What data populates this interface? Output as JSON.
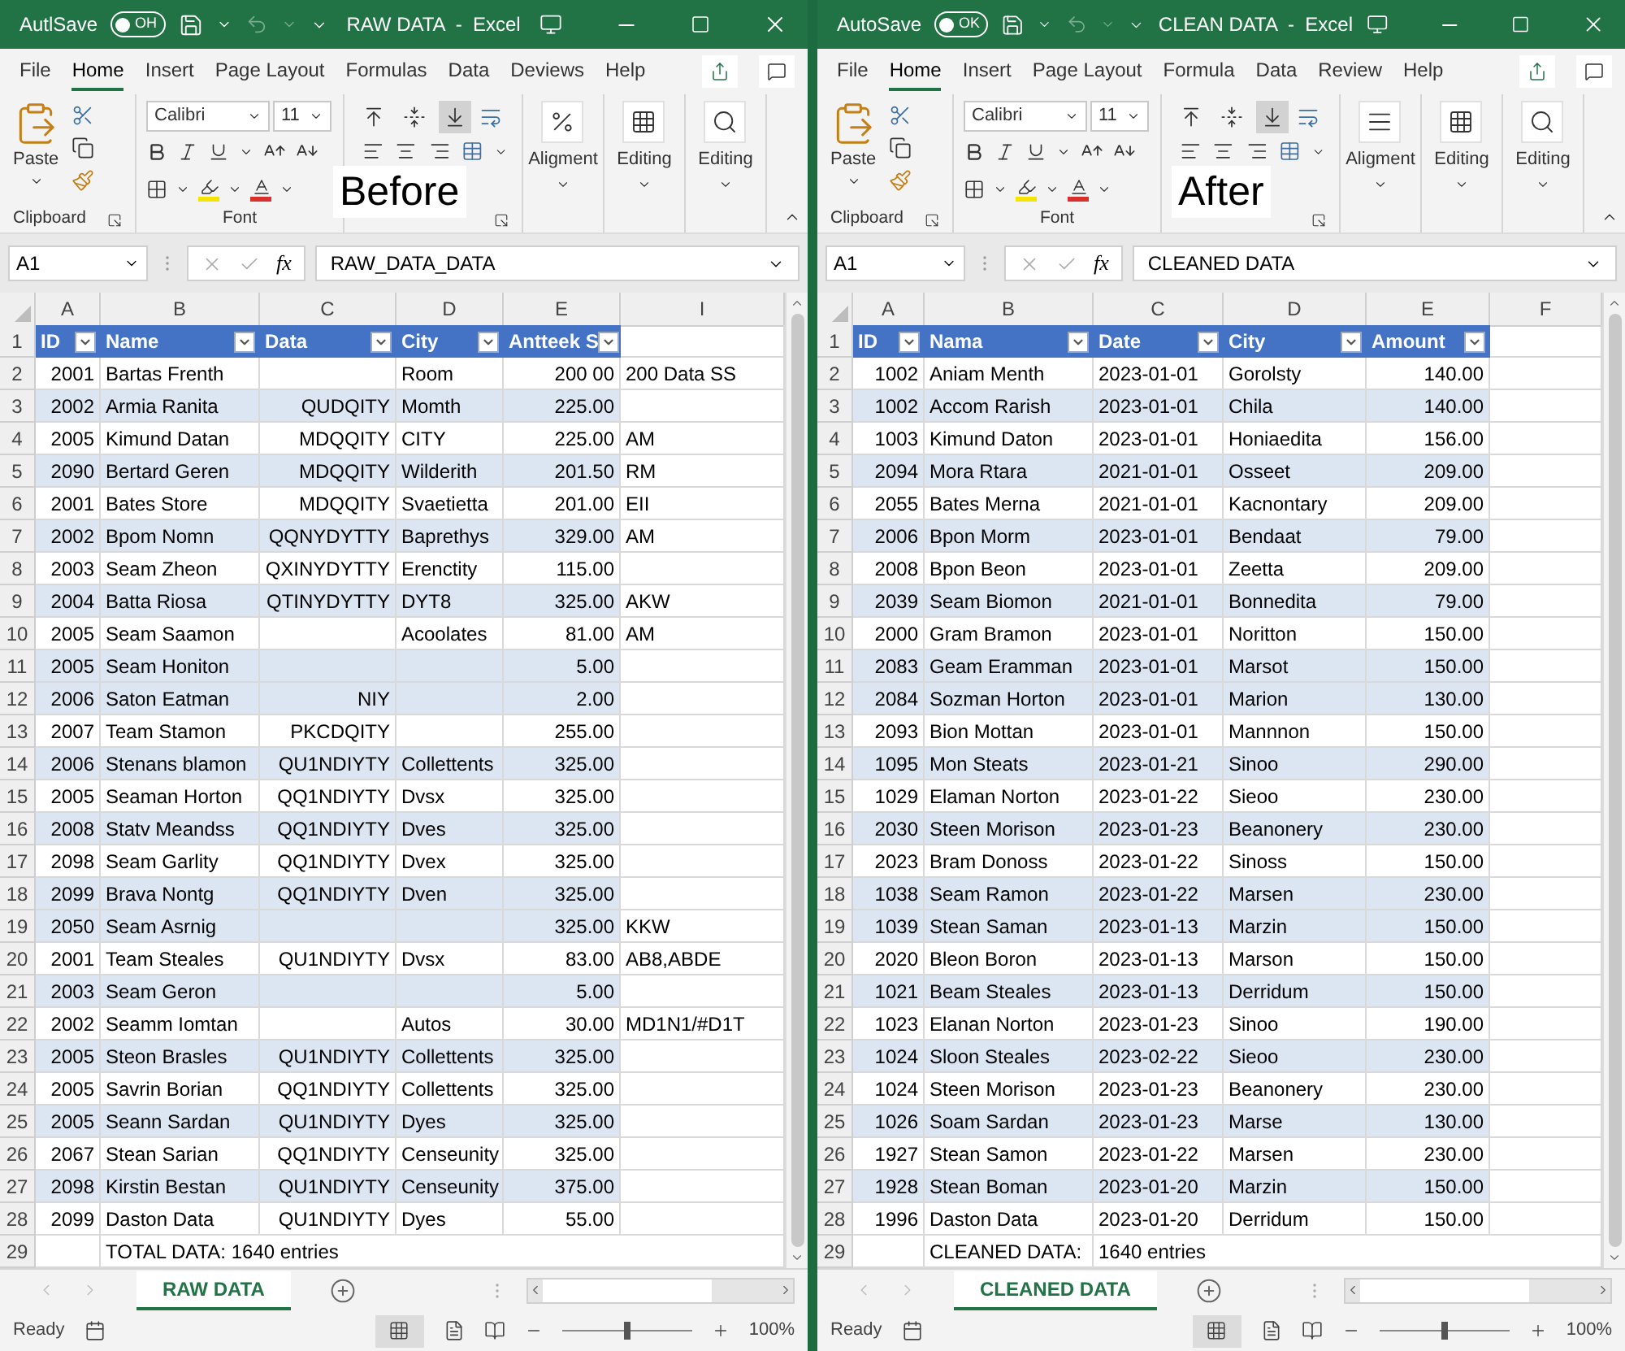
{
  "windows": [
    {
      "title": "RAW DATA  -  Excel",
      "autosave": {
        "label": "AutlSave",
        "toggle_text": "OH",
        "on": false
      },
      "menu_tabs": [
        {
          "label": "File",
          "selected": false
        },
        {
          "label": "Home",
          "selected": true
        },
        {
          "label": "Insert",
          "selected": false
        },
        {
          "label": "Page Layout",
          "selected": false
        },
        {
          "label": "Formulas",
          "selected": false
        },
        {
          "label": "Data",
          "selected": false
        },
        {
          "label": "Deviews",
          "selected": false
        },
        {
          "label": "Help",
          "selected": false
        }
      ],
      "ribbon": {
        "paste": "Paste",
        "clipboard_label": "Clipboard",
        "font": "Calibri",
        "font_size": "11",
        "font_label": "Font",
        "vertical_align": [
          {
            "kind": "top",
            "selected": false
          },
          {
            "kind": "middle",
            "selected": false
          },
          {
            "kind": "bottom",
            "selected": true
          }
        ],
        "big_buttons": [
          {
            "label": "Aligment",
            "kind": "percent"
          },
          {
            "label": "Editing",
            "kind": "table"
          },
          {
            "label": "Editing",
            "kind": "search"
          }
        ],
        "overlay": "Before"
      },
      "name_box": "A1",
      "fx": "fx",
      "formula": "RAW_DATA_DATA",
      "column_letters": [
        "A",
        "B",
        "C",
        "D",
        "E",
        "I"
      ],
      "rows": [
        {
          "number": "1",
          "kind": "header",
          "cells": [
            "ID",
            "Name",
            "Data",
            "City",
            "Antteek S",
            null
          ]
        },
        {
          "number": "2",
          "kind": "data",
          "shaded": false,
          "cells": [
            "2001",
            "Bartas Frenth",
            null,
            "Room",
            "200 00",
            "200 Data SS"
          ]
        },
        {
          "number": "3",
          "kind": "data",
          "shaded": true,
          "cells": [
            "2002",
            "Armia Ranita",
            "QUDQITY",
            "Momth",
            "225.00",
            null
          ]
        },
        {
          "number": "4",
          "kind": "data",
          "shaded": false,
          "cells": [
            "2005",
            "Kimund Datan",
            "MDQQITY",
            "CITY",
            "225.00",
            "AM"
          ]
        },
        {
          "number": "5",
          "kind": "data",
          "shaded": true,
          "cells": [
            "2090",
            "Bertard Geren",
            "MDQQITY",
            "Wilderith",
            "201.50",
            "RM"
          ]
        },
        {
          "number": "6",
          "kind": "data",
          "shaded": false,
          "cells": [
            "2001",
            "Bates Store",
            "MDQQITY",
            "Svaetietta",
            "201.00",
            "EII"
          ]
        },
        {
          "number": "7",
          "kind": "data",
          "shaded": true,
          "cells": [
            "2002",
            "Bpom Nomn",
            "QQNYDYTTY",
            "Baprethys",
            "329.00",
            "AM"
          ]
        },
        {
          "number": "8",
          "kind": "data",
          "shaded": false,
          "cells": [
            "2003",
            "Seam Zheon",
            "QXINYDYTTY",
            "Erenctity",
            "115.00",
            null
          ]
        },
        {
          "number": "9",
          "kind": "data",
          "shaded": true,
          "cells": [
            "2004",
            "Batta Riosa",
            "QTINYDYTTY",
            "DYT8",
            "325.00",
            "AKW"
          ]
        },
        {
          "number": "10",
          "kind": "data",
          "shaded": false,
          "cells": [
            "2005",
            "Seam Saamon",
            null,
            "Acoolates",
            "81.00",
            "AM"
          ]
        },
        {
          "number": "11",
          "kind": "data",
          "shaded": true,
          "cells": [
            "2005",
            "Seam Honiton",
            null,
            null,
            "5.00",
            null
          ]
        },
        {
          "number": "12",
          "kind": "data",
          "shaded": true,
          "cells": [
            "2006",
            "Saton Eatman",
            "NIY",
            null,
            "2.00",
            null
          ]
        },
        {
          "number": "13",
          "kind": "data",
          "shaded": false,
          "cells": [
            "2007",
            "Team Stamon",
            "PKCDQITY",
            null,
            "255.00",
            null
          ]
        },
        {
          "number": "14",
          "kind": "data",
          "shaded": true,
          "cells": [
            "2006",
            "Stenans blamon",
            "QU1NDIYTY",
            "Collettents",
            "325.00",
            null
          ]
        },
        {
          "number": "15",
          "kind": "data",
          "shaded": false,
          "cells": [
            "2005",
            "Seaman Horton",
            "QQ1NDIYTY",
            "Dvsx",
            "325.00",
            null
          ]
        },
        {
          "number": "16",
          "kind": "data",
          "shaded": true,
          "cells": [
            "2008",
            "Statv Meandss",
            "QQ1NDIYTY",
            "Dves",
            "325.00",
            null
          ]
        },
        {
          "number": "17",
          "kind": "data",
          "shaded": false,
          "cells": [
            "2098",
            "Seam Garlity",
            "QQ1NDIYTY",
            "Dvex",
            "325.00",
            null
          ]
        },
        {
          "number": "18",
          "kind": "data",
          "shaded": true,
          "cells": [
            "2099",
            "Brava Nontg",
            "QQ1NDIYTY",
            "Dven",
            "325.00",
            null
          ]
        },
        {
          "number": "19",
          "kind": "data",
          "shaded": true,
          "cells": [
            "2050",
            "Seam Asrnig",
            null,
            null,
            "325.00",
            "KKW"
          ]
        },
        {
          "number": "20",
          "kind": "data",
          "shaded": false,
          "cells": [
            "2001",
            "Team Steales",
            "QU1NDIYTY",
            "Dvsx",
            "83.00",
            "AB8,ABDE"
          ]
        },
        {
          "number": "21",
          "kind": "data",
          "shaded": true,
          "cells": [
            "2003",
            "Seam Geron",
            null,
            null,
            "5.00",
            null
          ]
        },
        {
          "number": "22",
          "kind": "data",
          "shaded": false,
          "cells": [
            "2002",
            "Seamm Iomtan",
            null,
            "Autos",
            "30.00",
            "MD1N1/#D1T"
          ]
        },
        {
          "number": "23",
          "kind": "data",
          "shaded": true,
          "cells": [
            "2005",
            "Steon Brasles",
            "QU1NDIYTY",
            "Collettents",
            "325.00",
            null
          ]
        },
        {
          "number": "24",
          "kind": "data",
          "shaded": false,
          "cells": [
            "2005",
            "Savrin Borian",
            "QQ1NDIYTY",
            "Collettents",
            "325.00",
            null
          ]
        },
        {
          "number": "25",
          "kind": "data",
          "shaded": true,
          "cells": [
            "2005",
            "Seann Sardan",
            "QU1NDIYTY",
            "Dyes",
            "325.00",
            null
          ]
        },
        {
          "number": "26",
          "kind": "data",
          "shaded": false,
          "cells": [
            "2067",
            "Stean Sarian",
            "QQ1NDIYTY",
            "Censeunity",
            "325.00",
            null
          ]
        },
        {
          "number": "27",
          "kind": "data",
          "shaded": true,
          "cells": [
            "2098",
            "Kirstin Bestan",
            "QU1NDIYTY",
            "Censeunity",
            "375.00",
            null
          ]
        },
        {
          "number": "28",
          "kind": "data",
          "shaded": false,
          "cells": [
            "2099",
            "Daston Data",
            "QU1NDIYTY",
            "Dyes",
            "55.00",
            null
          ]
        },
        {
          "number": "29",
          "kind": "summary",
          "cells": [
            null,
            "TOTAL DATA: 1640 entries",
            null,
            null,
            null,
            null
          ]
        }
      ],
      "sheet_tab": {
        "label": "RAW DATA",
        "selected": true
      },
      "status": "Ready",
      "zoom_slider": {
        "level": 0.5
      },
      "zoom": "100%"
    },
    {
      "title": "CLEAN DATA  -  Excel",
      "autosave": {
        "label": "AutoSave",
        "toggle_text": "OK",
        "on": false
      },
      "menu_tabs": [
        {
          "label": "File",
          "selected": false
        },
        {
          "label": "Home",
          "selected": true
        },
        {
          "label": "Insert",
          "selected": false
        },
        {
          "label": "Page Layout",
          "selected": false
        },
        {
          "label": "Formula",
          "selected": false
        },
        {
          "label": "Data",
          "selected": false
        },
        {
          "label": "Review",
          "selected": false
        },
        {
          "label": "Help",
          "selected": false
        }
      ],
      "ribbon": {
        "paste": "Paste",
        "clipboard_label": "Clipboard",
        "font": "Calibri",
        "font_size": "11",
        "font_label": "Font",
        "vertical_align": [
          {
            "kind": "top",
            "selected": false
          },
          {
            "kind": "middle",
            "selected": false
          },
          {
            "kind": "bottom",
            "selected": true
          }
        ],
        "big_buttons": [
          {
            "label": "Aligment",
            "kind": "lines"
          },
          {
            "label": "Editing",
            "kind": "table"
          },
          {
            "label": "Editing",
            "kind": "search"
          }
        ],
        "overlay": "After"
      },
      "name_box": "A1",
      "fx": "fx",
      "formula": "CLEANED DATA",
      "column_letters": [
        "A",
        "B",
        "C",
        "D",
        "E",
        "F"
      ],
      "rows": [
        {
          "number": "1",
          "kind": "header",
          "cells": [
            "ID",
            "Nama",
            "Date",
            "City",
            "Amount",
            null
          ]
        },
        {
          "number": "2",
          "kind": "data",
          "shaded": false,
          "cells": [
            "1002",
            "Aniam Menth",
            "2023-01-01",
            "Gorolsty",
            "140.00",
            null
          ]
        },
        {
          "number": "3",
          "kind": "data",
          "shaded": true,
          "cells": [
            "1002",
            "Accom Rarish",
            "2023-01-01",
            "Chila",
            "140.00",
            null
          ]
        },
        {
          "number": "4",
          "kind": "data",
          "shaded": false,
          "cells": [
            "1003",
            "Kimund Daton",
            "2023-01-01",
            "Honiaedita",
            "156.00",
            null
          ]
        },
        {
          "number": "5",
          "kind": "data",
          "shaded": true,
          "cells": [
            "2094",
            "Mora Rtara",
            "2021-01-01",
            "Osseet",
            "209.00",
            null
          ]
        },
        {
          "number": "6",
          "kind": "data",
          "shaded": false,
          "cells": [
            "2055",
            "Bates Merna",
            "2021-01-01",
            "Kacnontary",
            "209.00",
            null
          ]
        },
        {
          "number": "7",
          "kind": "data",
          "shaded": true,
          "cells": [
            "2006",
            "Bpon Morm",
            "2023-01-01",
            "Bendaat",
            "79.00",
            null
          ]
        },
        {
          "number": "8",
          "kind": "data",
          "shaded": false,
          "cells": [
            "2008",
            "Bpon Beon",
            "2023-01-01",
            "Zeetta",
            "209.00",
            null
          ]
        },
        {
          "number": "9",
          "kind": "data",
          "shaded": true,
          "cells": [
            "2039",
            "Seam Biomon",
            "2021-01-01",
            "Bonnedita",
            "79.00",
            null
          ]
        },
        {
          "number": "10",
          "kind": "data",
          "shaded": false,
          "cells": [
            "2000",
            "Gram Bramon",
            "2023-01-01",
            "Noritton",
            "150.00",
            null
          ]
        },
        {
          "number": "11",
          "kind": "data",
          "shaded": true,
          "cells": [
            "2083",
            "Geam Eramman",
            "2023-01-01",
            "Marsot",
            "150.00",
            null
          ]
        },
        {
          "number": "12",
          "kind": "data",
          "shaded": true,
          "cells": [
            "2084",
            "Sozman Horton",
            "2023-01-01",
            "Marion",
            "130.00",
            null
          ]
        },
        {
          "number": "13",
          "kind": "data",
          "shaded": false,
          "cells": [
            "2093",
            "Bion Mottan",
            "2023-01-01",
            "Mannnon",
            "150.00",
            null
          ]
        },
        {
          "number": "14",
          "kind": "data",
          "shaded": true,
          "cells": [
            "1095",
            "Mon Steats",
            "2023-01-21",
            "Sinoo",
            "290.00",
            null
          ]
        },
        {
          "number": "15",
          "kind": "data",
          "shaded": false,
          "cells": [
            "1029",
            "Elaman Norton",
            "2023-01-22",
            "Sieoo",
            "230.00",
            null
          ]
        },
        {
          "number": "16",
          "kind": "data",
          "shaded": true,
          "cells": [
            "2030",
            "Steen Morison",
            "2023-01-23",
            "Beanonery",
            "230.00",
            null
          ]
        },
        {
          "number": "17",
          "kind": "data",
          "shaded": false,
          "cells": [
            "2023",
            "Bram Donoss",
            "2023-01-22",
            "Sinoss",
            "150.00",
            null
          ]
        },
        {
          "number": "18",
          "kind": "data",
          "shaded": true,
          "cells": [
            "1038",
            "Seam Ramon",
            "2023-01-22",
            "Marsen",
            "230.00",
            null
          ]
        },
        {
          "number": "19",
          "kind": "data",
          "shaded": true,
          "cells": [
            "1039",
            "Stean Saman",
            "2023-01-13",
            "Marzin",
            "150.00",
            null
          ]
        },
        {
          "number": "20",
          "kind": "data",
          "shaded": false,
          "cells": [
            "2020",
            "Bleon Boron",
            "2023-01-13",
            "Marson",
            "150.00",
            null
          ]
        },
        {
          "number": "21",
          "kind": "data",
          "shaded": true,
          "cells": [
            "1021",
            "Beam Steales",
            "2023-01-13",
            "Derridum",
            "150.00",
            null
          ]
        },
        {
          "number": "22",
          "kind": "data",
          "shaded": false,
          "cells": [
            "1023",
            "Elanan Norton",
            "2023-01-23",
            "Sinoo",
            "190.00",
            null
          ]
        },
        {
          "number": "23",
          "kind": "data",
          "shaded": true,
          "cells": [
            "1024",
            "Sloon Steales",
            "2023-02-22",
            "Sieoo",
            "230.00",
            null
          ]
        },
        {
          "number": "24",
          "kind": "data",
          "shaded": false,
          "cells": [
            "1024",
            "Steen Morison",
            "2023-01-23",
            "Beanonery",
            "230.00",
            null
          ]
        },
        {
          "number": "25",
          "kind": "data",
          "shaded": true,
          "cells": [
            "1026",
            "Soam Sardan",
            "2023-01-23",
            "Marse",
            "130.00",
            null
          ]
        },
        {
          "number": "26",
          "kind": "data",
          "shaded": false,
          "cells": [
            "1927",
            "Stean Samon",
            "2023-01-22",
            "Marsen",
            "230.00",
            null
          ]
        },
        {
          "number": "27",
          "kind": "data",
          "shaded": true,
          "cells": [
            "1928",
            "Stean Boman",
            "2023-01-20",
            "Marzin",
            "150.00",
            null
          ]
        },
        {
          "number": "28",
          "kind": "data",
          "shaded": false,
          "cells": [
            "1996",
            "Daston Data",
            "2023-01-20",
            "Derridum",
            "150.00",
            null
          ]
        },
        {
          "number": "29",
          "kind": "summary",
          "cells": [
            null,
            "CLEANED DATA:",
            "1640 entries",
            null,
            null,
            null
          ]
        }
      ],
      "sheet_tab": {
        "label": "CLEANED DATA",
        "selected": true
      },
      "status": "Ready",
      "zoom_slider": {
        "level": 0.5
      },
      "zoom": "100%"
    }
  ]
}
